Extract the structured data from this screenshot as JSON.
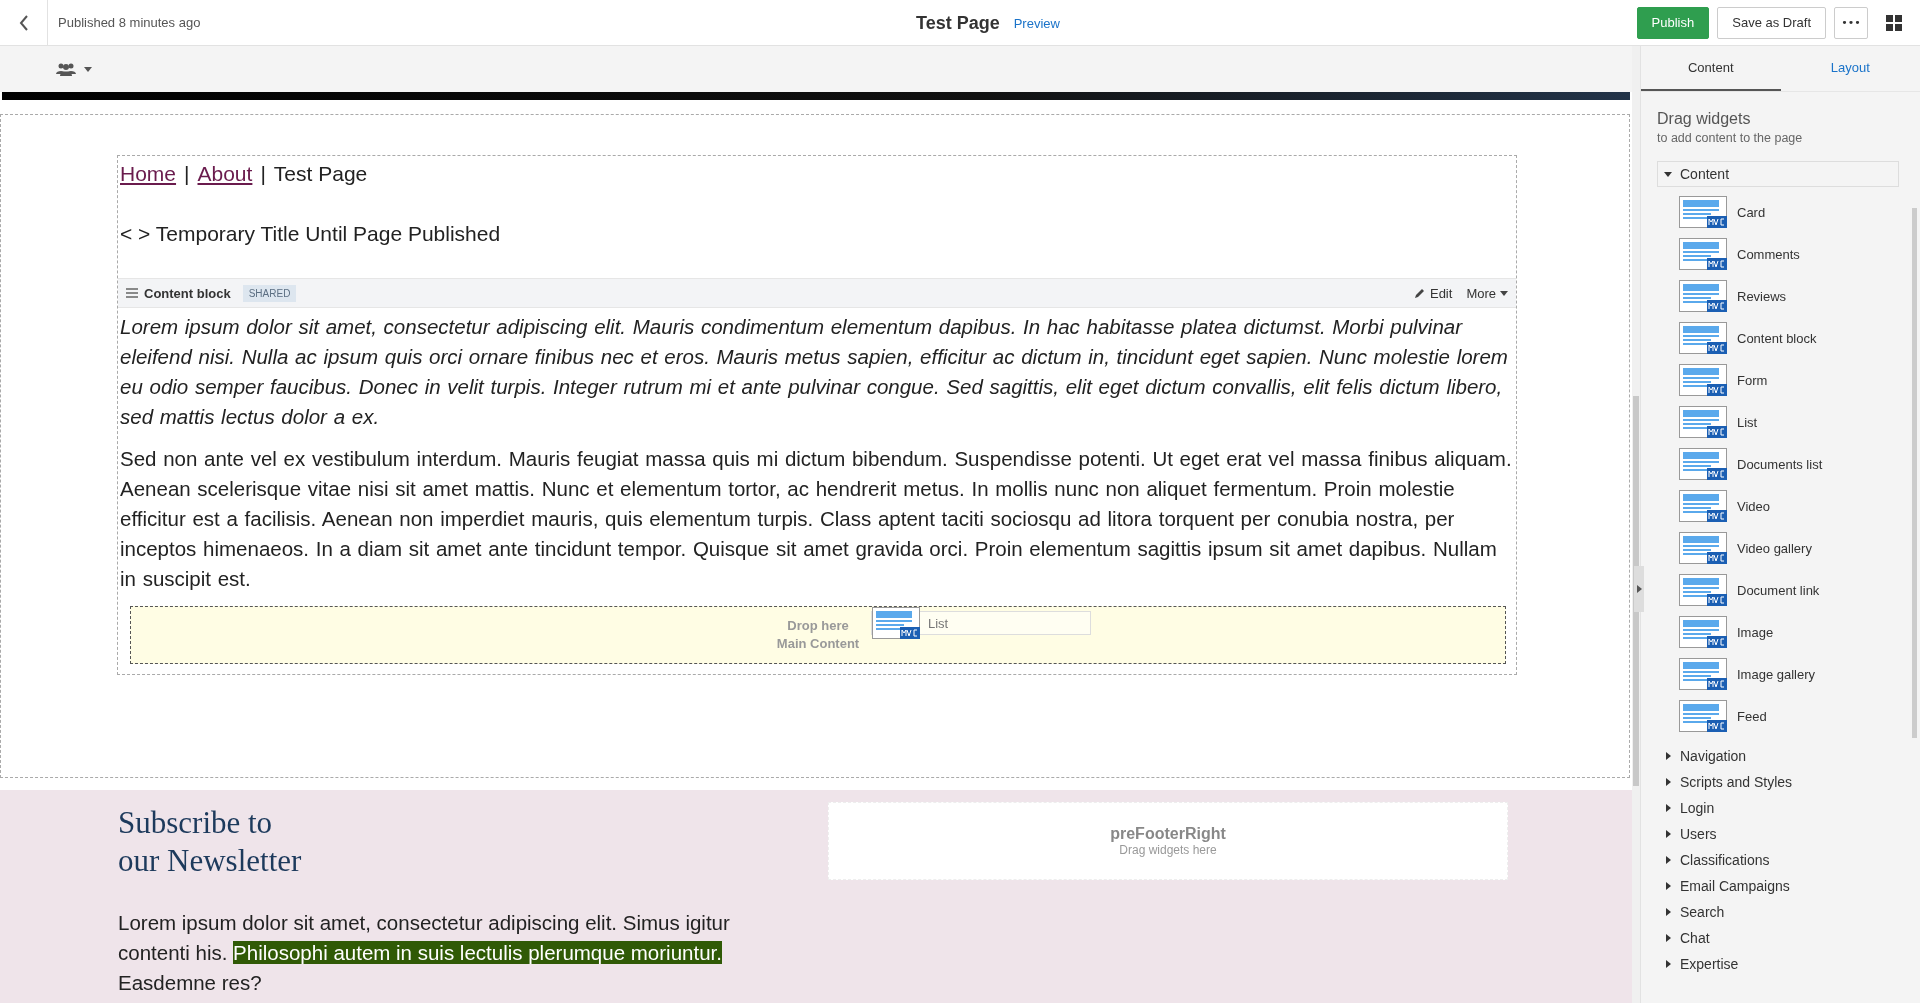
{
  "header": {
    "status": "Published 8 minutes ago",
    "title": "Test Page",
    "preview_link": "Preview",
    "buttons": [
      {
        "label": "Publish",
        "kind": "primary"
      },
      {
        "label": "Save as Draft",
        "kind": "secondary"
      }
    ],
    "more_label": "•••"
  },
  "page": {
    "breadcrumb": [
      {
        "label": "Home",
        "kind": "link"
      },
      {
        "label": "|",
        "kind": "separator"
      },
      {
        "label": "About",
        "kind": "link"
      },
      {
        "label": "|",
        "kind": "separator"
      },
      {
        "label": "Test Page",
        "kind": "current"
      }
    ],
    "title": "< > Temporary Title Until Page Published",
    "content_block": {
      "name": "Content block",
      "badge": "SHARED",
      "edit": "Edit",
      "more": "More",
      "paragraphs": [
        {
          "kind": "italic",
          "text": "Lorem ipsum dolor sit amet, consectetur adipiscing elit. Mauris condimentum elementum dapibus. In hac habitasse platea dictumst. Morbi pulvinar eleifend nisi. Nulla ac ipsum quis orci ornare finibus nec et eros. Mauris metus sapien, efficitur ac dictum in, tincidunt eget sapien. Nunc molestie lorem eu odio semper faucibus. Donec in velit turpis. Integer rutrum mi et ante pulvinar congue. Sed sagittis, elit eget dictum convallis, elit felis dictum libero, sed mattis lectus dolor a ex."
        },
        {
          "kind": "normal",
          "text": "Sed non ante vel ex vestibulum interdum. Mauris feugiat massa quis mi dictum bibendum. Suspendisse potenti. Ut eget erat vel massa finibus aliquam. Aenean scelerisque vitae nisi sit amet mattis. Nunc et elementum tortor, ac hendrerit metus. In mollis nunc non aliquet fermentum. Proin molestie efficitur est a facilisis. Aenean non imperdiet mauris, quis elementum turpis. Class aptent taciti sociosqu ad litora torquent per conubia nostra, per inceptos himenaeos. In a diam sit amet ante tincidunt tempor. Quisque sit amet gravida orci. Proin elementum sagittis ipsum sit amet dapibus. Nullam in suscipit est."
        }
      ]
    },
    "drop_zone": {
      "hint": "Drop here",
      "zone": "Main Content",
      "dragged_widget": "List"
    }
  },
  "footer": {
    "heading_lines": [
      "Subscribe to",
      "our Newsletter"
    ],
    "text_before": "Lorem ipsum dolor sit amet, consectetur adipiscing elit. Simus igitur contenti his. ",
    "highlight": "Philosophi autem in suis lectulis plerumque moriuntur.",
    "text_after": " Easdemne res?",
    "right_zone": {
      "title": "preFooterRight",
      "hint": "Drag widgets here"
    }
  },
  "sidebar": {
    "tabs": [
      {
        "label": "Content",
        "selected": true
      },
      {
        "label": "Layout",
        "selected": false
      }
    ],
    "heading": "Drag widgets",
    "subheading": "to add content to the page",
    "categories": [
      {
        "label": "Content",
        "expanded": true,
        "widgets": [
          "Card",
          "Comments",
          "Reviews",
          "Content block",
          "Form",
          "List",
          "Documents list",
          "Video",
          "Video gallery",
          "Document link",
          "Image",
          "Image gallery",
          "Feed"
        ]
      },
      {
        "label": "Navigation",
        "expanded": false
      },
      {
        "label": "Scripts and Styles",
        "expanded": false
      },
      {
        "label": "Login",
        "expanded": false
      },
      {
        "label": "Users",
        "expanded": false
      },
      {
        "label": "Classifications",
        "expanded": false
      },
      {
        "label": "Email Campaigns",
        "expanded": false
      },
      {
        "label": "Search",
        "expanded": false
      },
      {
        "label": "Chat",
        "expanded": false
      },
      {
        "label": "Expertise",
        "expanded": false
      }
    ]
  }
}
